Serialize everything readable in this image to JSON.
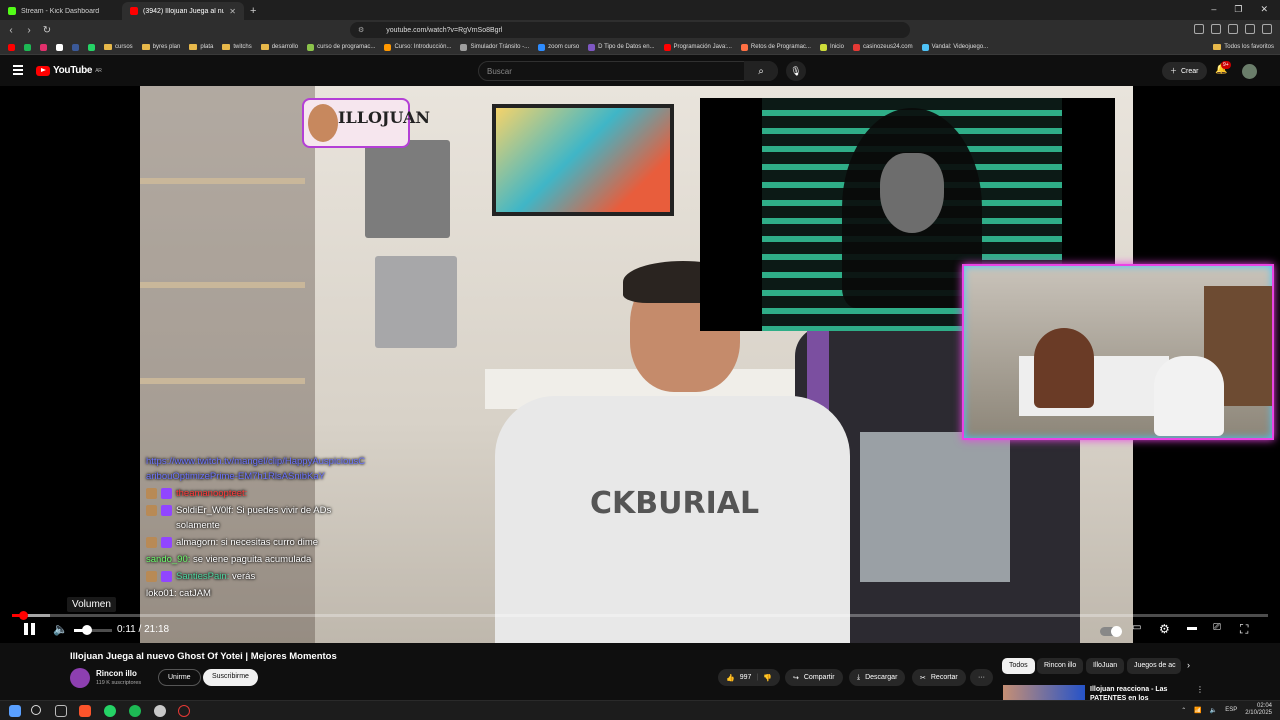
{
  "browser": {
    "tabs": [
      {
        "label": "Stream - Kick Dashboard",
        "color": "#53fc18"
      },
      {
        "label": "(3942) Illojuan Juega al nuevo Ghost Of Yotei | Mejores Momentos",
        "color": "#ff0000"
      }
    ],
    "new_tab": "+",
    "url": "youtube.com/watch?v=RgVmSo8Bgrl",
    "bookmarks": [
      {
        "label": "",
        "kind": "icon",
        "color": "#ff0000"
      },
      {
        "label": "",
        "kind": "icon",
        "color": "#1db954"
      },
      {
        "label": "",
        "kind": "icon",
        "color": "#e1306c"
      },
      {
        "label": "",
        "kind": "icon",
        "color": "#ffffff"
      },
      {
        "label": "",
        "kind": "icon",
        "color": "#3b5998"
      },
      {
        "label": "",
        "kind": "icon",
        "color": "#25d366"
      },
      {
        "label": "cursos",
        "kind": "folder"
      },
      {
        "label": "byres plan",
        "kind": "folder"
      },
      {
        "label": "plata",
        "kind": "folder"
      },
      {
        "label": "twitchs",
        "kind": "folder"
      },
      {
        "label": "desarrollo",
        "kind": "folder"
      },
      {
        "label": "curso de programac...",
        "kind": "icon",
        "color": "#8bc34a"
      },
      {
        "label": "Curso: Introducción...",
        "kind": "icon",
        "color": "#ff9800"
      },
      {
        "label": "Simulador Tránsito -...",
        "kind": "icon",
        "color": "#9e9e9e"
      },
      {
        "label": "zoom curso",
        "kind": "icon",
        "color": "#2d8cff"
      },
      {
        "label": "D Tipo de Datos en...",
        "kind": "icon",
        "color": "#7e57c2"
      },
      {
        "label": "Programación Java:...",
        "kind": "icon",
        "color": "#ff0000"
      },
      {
        "label": "Retos de Programac...",
        "kind": "icon",
        "color": "#ff7043"
      },
      {
        "label": "Inicio",
        "kind": "icon",
        "color": "#cddc39"
      },
      {
        "label": "casinozeus24.com",
        "kind": "icon",
        "color": "#e53935"
      },
      {
        "label": "Vandal: Videojuego...",
        "kind": "icon",
        "color": "#4fc3f7"
      }
    ],
    "all_bookmarks": "Todos los favoritos"
  },
  "youtube": {
    "logo_text": "YouTube",
    "logo_region": "AR",
    "search_placeholder": "Buscar",
    "create_label": "Crear",
    "notifications": "9+"
  },
  "player": {
    "channel_badge_text": "ILLOJUAN",
    "shirt_text": "CKBURIAL",
    "chat": [
      {
        "user": "",
        "text": "https://www.twitch.tv/mangel/clip/HappyAuspiciousCaribouOptimizePrime-EM7h1RlsASnibKaY",
        "user_color": "#6d75ff",
        "badge": "",
        "kind": "link"
      },
      {
        "user": "theamanoopteet:",
        "text": "",
        "user_color": "#ff3b3b",
        "badge": "#b88a56",
        "kind": "msg"
      },
      {
        "user": "SoldiEr_W0lf:",
        "text": "Si puedes vivir de ADs solamente",
        "user_color": "#ffffff",
        "badge": "#b88a56",
        "kind": "msg"
      },
      {
        "user": "almagorn:",
        "text": "si necesitas curro dime",
        "user_color": "#ffffff",
        "badge": "#b88a56",
        "kind": "msg"
      },
      {
        "user": "sando_90:",
        "text": "se viene paguita acumulada",
        "user_color": "#6dff6d",
        "badge": "",
        "kind": "msg"
      },
      {
        "user": "SantiesPain:",
        "text": "verás",
        "user_color": "#4dd6a0",
        "badge": "#b88a56",
        "kind": "msg"
      },
      {
        "user": "loko01:",
        "text": "catJAM",
        "user_color": "#ffffff",
        "badge": "",
        "kind": "msg"
      }
    ],
    "volume_tooltip": "Volumen",
    "current_time": "0:11",
    "duration": "21:18",
    "progress_fraction": 0.0086,
    "loaded_fraction": 0.03,
    "volume_fraction": 0.35
  },
  "video": {
    "title": "Illojuan Juega al nuevo Ghost Of Yotei | Mejores Momentos",
    "channel": "Rincon illo",
    "subscribers": "119 K suscriptores",
    "join_label": "Unirme",
    "subscribe_label": "Suscribirme",
    "likes": "997",
    "share_label": "Compartir",
    "download_label": "Descargar",
    "clip_label": "Recortar",
    "more": "···"
  },
  "recommendations": {
    "chips": [
      "Todos",
      "Rincon illo",
      "IlloJuan",
      "Juegos de ac"
    ],
    "first_title": "Illojuan reacciona - Las PATENTES en los"
  },
  "taskbar": {
    "language": "ESP",
    "time": "02:04",
    "date": "2/10/2025"
  }
}
